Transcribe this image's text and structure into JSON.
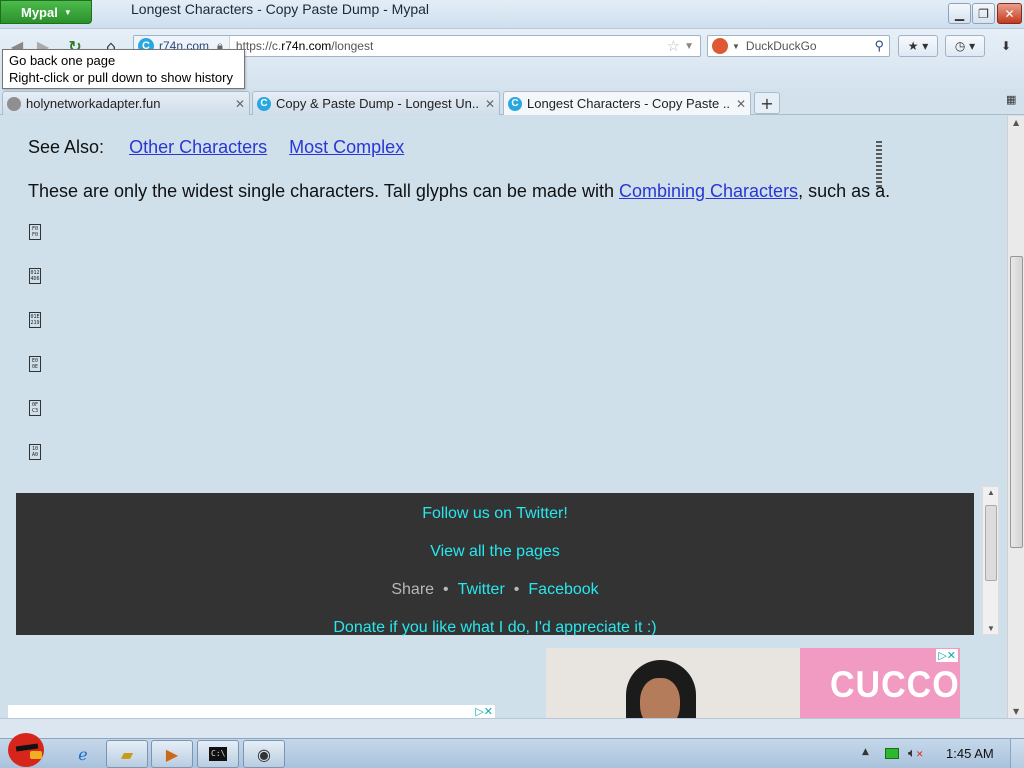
{
  "browser": {
    "app_button": "Mypal",
    "window_title": "Longest Characters - Copy Paste Dump - Mypal",
    "identity_domain": "r74n.com",
    "url_prefix": "https://c.",
    "url_host": "r74n.com",
    "url_path": "/longest",
    "search_placeholder": "DuckDuckGo",
    "tooltip_line1": "Go back one page",
    "tooltip_line2": "Right-click or pull down to show history"
  },
  "tabs": [
    {
      "label": "holynetworkadapter.fun",
      "icon": "globe-icon"
    },
    {
      "label": "Copy & Paste Dump - Longest Un...",
      "icon": "r74n-c-icon"
    },
    {
      "label": "Longest Characters - Copy Paste ...",
      "icon": "r74n-c-icon",
      "active": true
    }
  ],
  "page": {
    "see_also_label": "See Also:",
    "see_also_link1": "Other Characters",
    "see_also_link2": "Most Complex",
    "intro_text": "These are only the widest single characters. Tall glyphs can be made with ",
    "intro_link": "Combining Characters",
    "intro_suffix": ", such as a.",
    "glyphs": [
      {
        "top": "F0",
        "bottom": "F0"
      },
      {
        "top": "012",
        "bottom": "4D6"
      },
      {
        "top": "01E",
        "bottom": "219"
      },
      {
        "top": "E0",
        "bottom": "0E"
      },
      {
        "top": "0F",
        "bottom": "C3"
      },
      {
        "top": "10",
        "bottom": "A0"
      }
    ]
  },
  "footer": {
    "follow": "Follow us on Twitter!",
    "view_all": "View all the pages",
    "share": "Share",
    "twitter": "Twitter",
    "facebook": "Facebook",
    "separator": "•",
    "donate": "Donate if you like what I do, I'd appreciate it :)"
  },
  "ads": {
    "brand": "CUCCOO",
    "adchoices": "▷✕"
  },
  "taskbar": {
    "clock": "1:45 AM"
  },
  "colors": {
    "page_bg": "#cfe0ea",
    "link": "#2a36d6",
    "footer_bg": "#333333",
    "footer_link": "#27e8ef"
  }
}
